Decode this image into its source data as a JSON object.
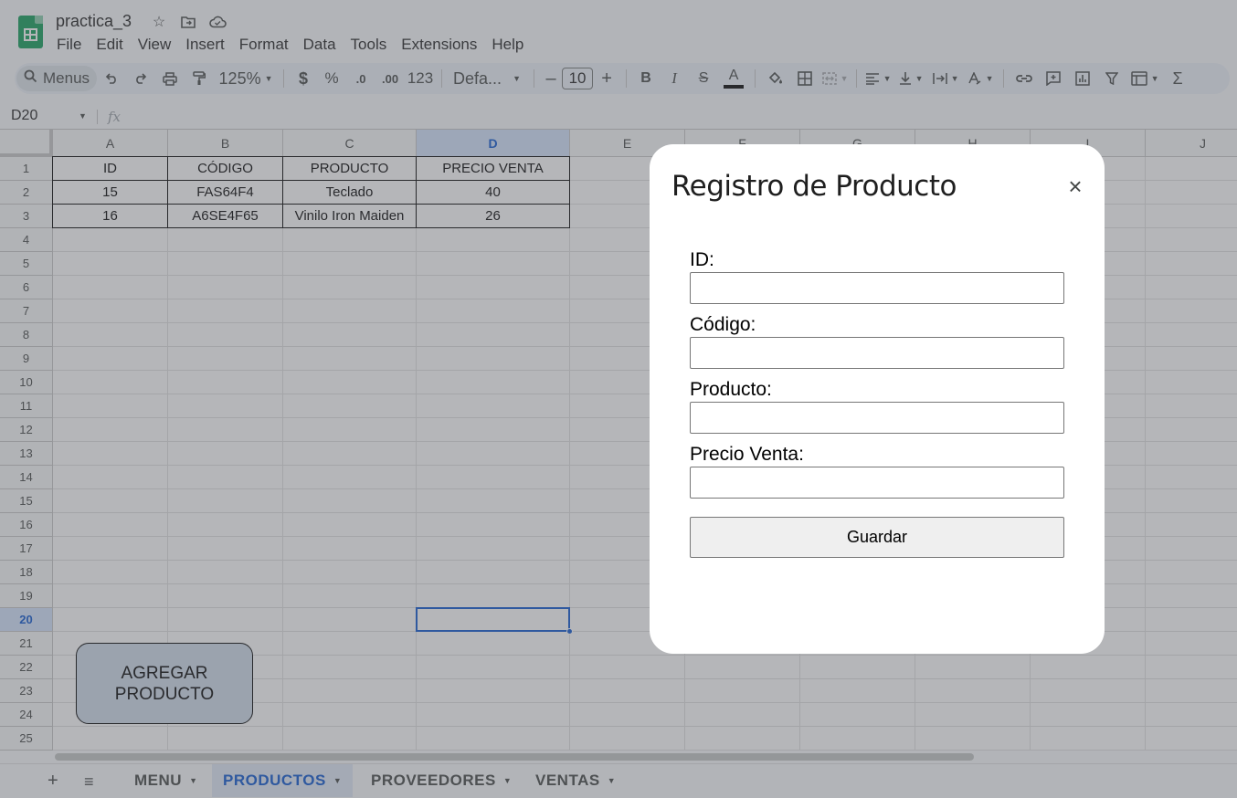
{
  "app": {
    "doc_title": "practica_3",
    "menu": [
      "File",
      "Edit",
      "View",
      "Insert",
      "Format",
      "Data",
      "Tools",
      "Extensions",
      "Help"
    ]
  },
  "toolbar": {
    "search_label": "Menus",
    "zoom": "125%",
    "currency": "$",
    "percent": "%",
    "decrease_decimals": ".0",
    "increase_decimals": ".00",
    "number_format": "123",
    "font_family": "Defa...",
    "font_size": "10",
    "minus": "–",
    "plus": "+",
    "bold": "B",
    "italic": "I",
    "strike": "S",
    "text_color": "A",
    "sum": "Σ"
  },
  "formula_bar": {
    "name_box": "D20",
    "fx": "fx"
  },
  "sheet": {
    "columns": [
      "A",
      "B",
      "C",
      "D",
      "E",
      "F",
      "G",
      "H",
      "I",
      "J"
    ],
    "selected_column": "D",
    "selected_row": "20",
    "rows": [
      "1",
      "2",
      "3",
      "4",
      "5",
      "6",
      "7",
      "8",
      "9",
      "10",
      "11",
      "12",
      "13",
      "14",
      "15",
      "16",
      "17",
      "18",
      "19",
      "20",
      "21",
      "22",
      "23",
      "24",
      "25"
    ],
    "table": {
      "headers": [
        "ID",
        "CÓDIGO",
        "PRODUCTO",
        "PRECIO VENTA"
      ],
      "data": [
        [
          "15",
          "FAS64F4",
          "Teclado",
          "40"
        ],
        [
          "16",
          "A6SE4F65",
          "Vinilo Iron Maiden",
          "26"
        ]
      ]
    },
    "add_product_button": "AGREGAR\nPRODUCTO"
  },
  "sheet_tabs": {
    "add": "+",
    "all": "≡",
    "tabs": [
      {
        "label": "MENU",
        "active": false
      },
      {
        "label": "PRODUCTOS",
        "active": true
      },
      {
        "label": "PROVEEDORES",
        "active": false
      },
      {
        "label": "VENTAS",
        "active": false
      }
    ]
  },
  "dialog": {
    "title": "Registro de Producto",
    "close": "×",
    "fields": [
      {
        "label": "ID:",
        "value": ""
      },
      {
        "label": "Código:",
        "value": ""
      },
      {
        "label": "Producto:",
        "value": ""
      },
      {
        "label": "Precio Venta:",
        "value": ""
      }
    ],
    "submit_label": "Guardar"
  },
  "colors": {
    "accent": "#0b57d0",
    "sheets_green": "#0f9d58",
    "button_fill": "#cfdceb"
  }
}
